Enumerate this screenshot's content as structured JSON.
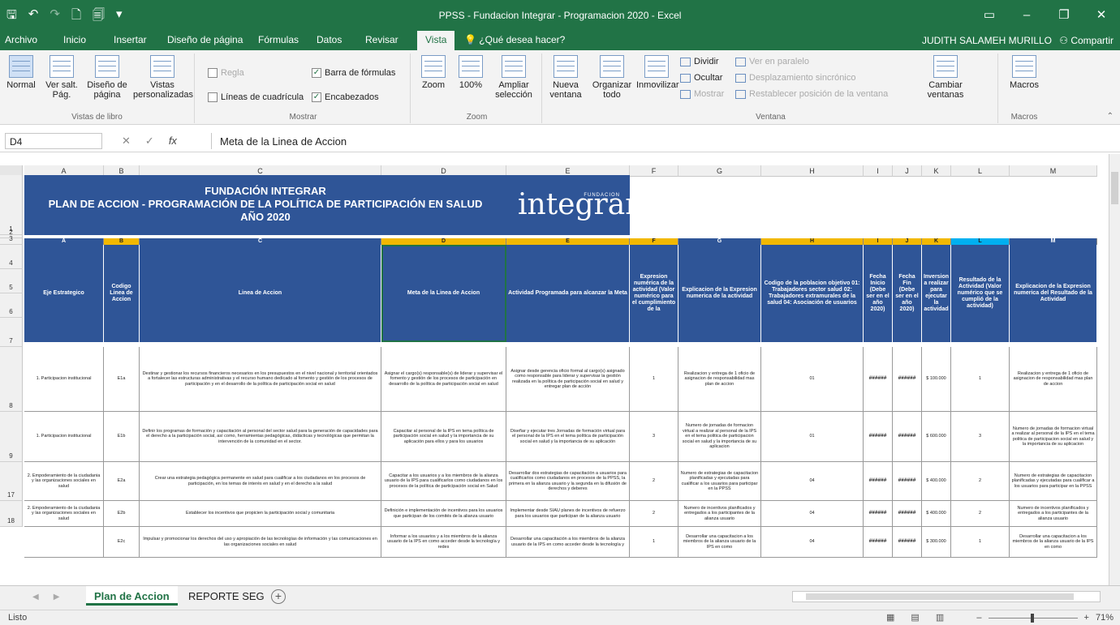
{
  "window": {
    "title": "PPSS - Fundacion Integrar - Programacion 2020 - Excel",
    "qat_icons": [
      "save-icon",
      "undo-icon",
      "redo-icon",
      "new-icon",
      "print-preview-icon",
      "customize-icon"
    ],
    "controls": [
      "ribbon-display-icon",
      "minimize-icon",
      "maximize-icon",
      "close-icon"
    ]
  },
  "ribbon_tabs": [
    "Archivo",
    "Inicio",
    "Insertar",
    "Diseño de página",
    "Fórmulas",
    "Datos",
    "Revisar",
    "Vista",
    "¿Qué desea hacer?"
  ],
  "active_tab": "Vista",
  "user": "JUDITH SALAMEH MURILLO",
  "share_label": "Compartir",
  "ribbon": {
    "vistas": {
      "label": "Vistas de libro",
      "buttons": [
        "Normal",
        "Ver salt. Pág.",
        "Diseño de página",
        "Vistas personalizadas"
      ]
    },
    "mostrar": {
      "label": "Mostrar",
      "checks": [
        {
          "label": "Regla",
          "checked": false,
          "disabled": true
        },
        {
          "label": "Barra de fórmulas",
          "checked": true,
          "disabled": false
        },
        {
          "label": "Líneas de cuadrícula",
          "checked": false,
          "disabled": false
        },
        {
          "label": "Encabezados",
          "checked": true,
          "disabled": false
        }
      ]
    },
    "zoom": {
      "label": "Zoom",
      "buttons": [
        "Zoom",
        "100%",
        "Ampliar selección"
      ]
    },
    "ventana": {
      "label": "Ventana",
      "buttons": [
        "Nueva ventana",
        "Organizar todo",
        "Inmovilizar"
      ],
      "small": [
        "Dividir",
        "Ocultar",
        "Mostrar"
      ],
      "small_disabled": [
        "Ver en paralelo",
        "Desplazamiento sincrónico",
        "Restablecer posición de la ventana"
      ],
      "switch": "Cambiar ventanas"
    },
    "macros": {
      "label": "Macros",
      "button": "Macros"
    }
  },
  "formula_bar": {
    "name_box": "D4",
    "formula": "Meta de la Linea de Accion"
  },
  "sheet": {
    "column_letters": [
      "A",
      "B",
      "C",
      "D",
      "E",
      "F",
      "G",
      "H",
      "I",
      "J",
      "K",
      "L",
      "M"
    ],
    "banner": {
      "line1": "FUNDACIÓN INTEGRAR",
      "line2": "PLAN DE ACCION - PROGRAMACIÓN DE LA POLÍTICA DE PARTICIPACIÓN EN SALUD",
      "line3": "AÑO 2020"
    },
    "logo": {
      "name": "integrar",
      "tag": "FUNDACION"
    },
    "row_numbers": [
      "1",
      "2",
      "3",
      "4",
      "5",
      "6",
      "7",
      "8",
      "9",
      "17",
      "18"
    ],
    "headers": [
      "Eje Estrategico",
      "Codigo Linea de Accion",
      "Linea de Accion",
      "Meta de la Linea de Accion",
      "Actividad Programada para alcanzar la Meta",
      "Expresion numérica de la actividad (Valor numérico para el cumplimiento de la",
      "Explicacion de la Expresion numerica de la actividad",
      "Codigo de la poblacion objetivo 01: Trabajadores sector salud 02: Trabajadores extramurales de la salud 04: Asociación de usuarios",
      "Fecha Inicio (Debe ser en el año 2020)",
      "Fecha Fin (Debe ser en el año 2020)",
      "Inversion a realizar para ejecutar la actividad",
      "Resultado de la Actividad (Valor numérico que se cumplió de la actividad)",
      "Explicacion de la Expresion numerica del Resultado de la Actividad"
    ],
    "rows": [
      {
        "eje": "1. Participacion institucional",
        "codigo": "E1a",
        "linea": "Destinar y gestionar los recursos financieros necesarios en los presupuestos en el nivel nacional y territorial orientados a fortalecer las estructuras administrativas y el recurso humano dedicado al fomento y gestión de los procesos de participación y en el desarrollo de la política de participación social en salud",
        "meta": "Asignar el cargo(s) responsable(s) de liderar y supervisar el fomento y gestión de los procesos de participación en desarrollo de la política de participación social en salud",
        "actividad": "Asignar desde gerencia oficio formal al cargo(s) asignado como responsable para liderar y supervisar la gestión realizada en la política de participación social en salud y entregar plan de acción",
        "expresion": "1",
        "explicacion": "Realizacion y entrega de 1 oficio de asignacion de responsabilidad mas plan de accion",
        "codpob": "01",
        "inicio": "######",
        "fin": "######",
        "inversion": "$ 100.000",
        "resultado": "1",
        "explres": "Realizacion y entrega de 1 oficio de asignacion de responsabilidad mas plan de accion"
      },
      {
        "eje": "1. Participacion institucional",
        "codigo": "E1b",
        "linea": "Definir los programas de formación y capacitación al personal del sector salud para la generación de capacidades para el derecho a la participación social, así como, herramientas pedagógicas, didácticas y tecnológicas que permitan la intervención de la comunidad en el sector.",
        "meta": "Capacitar al personal de la IPS en tema política de participación social en salud y la importancia de su aplicación para ellos y para los usuarios",
        "actividad": "Diseñar y ejecutar tres Jornadas de formación virtual para el personal de la IPS en el tema política de participación social en salud y la importancia de su aplicación",
        "expresion": "3",
        "explicacion": "Numero de jornadas de formacion virtual a realizar al personal de la IPS en el tema politica de participacion social en salud y la importancia de su aplicacion",
        "codpob": "01",
        "inicio": "######",
        "fin": "######",
        "inversion": "$ 600.000",
        "resultado": "3",
        "explres": "Numero de jornadas de formacion virtual a realizar al personal de la IPS en el tema politica de participacion social en salud y la importancia de su aplicacion"
      },
      {
        "eje": "2. Empoderamiento de la ciudadania y las organizaciones sociales en salud",
        "codigo": "E2a",
        "linea": "Crear una estrategia pedagógica permanente en salud para cualificar a los ciudadanos en los procesos de participación, en los temas de interés en salud y en el derecho a la salud",
        "meta": "Capacitar a los usuarios y a los miembros de la alianza usuario de la IPS para cualificarlos como ciudadanos en los procesos de la política de participación social en Salud",
        "actividad": "Desarrollar dos estrategias de capacitación a usuarios para cualificarlos como ciudadanos en procesos de la PPSS, la primera en la alianza usuario y la segunda en la difusión de derechos y deberes",
        "expresion": "2",
        "explicacion": "Numero de estrategias de capacitacion planificadas y ejecutadas para cualificar a los usuarios para participar en la PPSS",
        "codpob": "04",
        "inicio": "######",
        "fin": "######",
        "inversion": "$ 400.000",
        "resultado": "2",
        "explres": "Numero de estrategias de capacitacion planificadas y ejecutadas para cualificar a los usuarios para participar en la PPSS"
      },
      {
        "eje": "2. Empoderamiento de la ciudadania y las organizaciones sociales en salud",
        "codigo": "E2b",
        "linea": "Establecer los incentivos que propicien la participación social y comunitaria",
        "meta": "Definición e implementación de incentivos para los usuarios que participan de los comités de la alianza usuario",
        "actividad": "Implementar desde SIAU planes de incentivos de refuerzo para los usuarios que participan de la alianza usuario",
        "expresion": "2",
        "explicacion": "Numero de incentivos planificados y entregados a los participantes de la alianza usuario",
        "codpob": "04",
        "inicio": "######",
        "fin": "######",
        "inversion": "$ 400.000",
        "resultado": "2",
        "explres": "Numero de incentivos planificados y entregados a los participantes de la alianza usuario"
      },
      {
        "eje": "",
        "codigo": "E2c",
        "linea": "Impulsar y promocionar los derechos del uso y apropiación de las tecnologías de información y las comunicaciones en las organizaciones sociales en salud",
        "meta": "Informar a los usuarios y a los miembros de la alianza usuario de la IPS en como acceder desde la tecnología y redes",
        "actividad": "Desarrollar una capacitación a los miembros de la alianza usuario de la IPS en como acceder desde la tecnología y",
        "expresion": "1",
        "explicacion": "Desarrollar una capacitacion a los miembros de la alianza usuario de la IPS en como",
        "codpob": "04",
        "inicio": "######",
        "fin": "######",
        "inversion": "$ 300.000",
        "resultado": "1",
        "explres": "Desarrollar una capacitacion a los miembros de la alianza usuario de la IPS en como"
      }
    ],
    "tabs": [
      "Plan de Accion",
      "REPORTE SEG"
    ],
    "active_sheet": "Plan de Accion"
  },
  "status": {
    "ready": "Listo",
    "zoom": "71%"
  }
}
